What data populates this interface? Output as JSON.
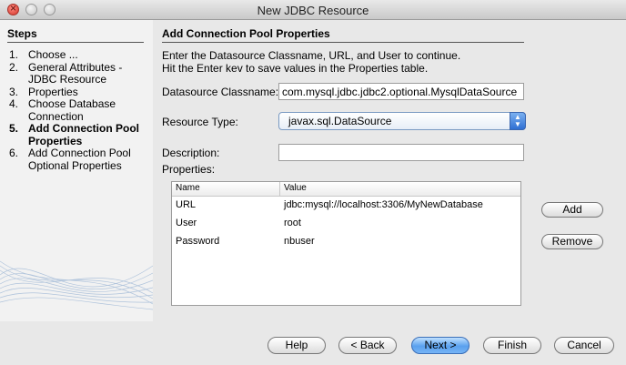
{
  "window": {
    "title": "New JDBC Resource"
  },
  "sidebar": {
    "heading": "Steps",
    "steps": [
      {
        "num": "1.",
        "label": "Choose ..."
      },
      {
        "num": "2.",
        "label": "General Attributes -"
      },
      {
        "num": "",
        "label": "JDBC Resource"
      },
      {
        "num": "3.",
        "label": "Properties"
      },
      {
        "num": "4.",
        "label": "Choose Database"
      },
      {
        "num": "",
        "label": "Connection"
      },
      {
        "num": "5.",
        "label": "Add Connection Pool"
      },
      {
        "num": "",
        "label": "Properties"
      },
      {
        "num": "6.",
        "label": "Add Connection Pool"
      },
      {
        "num": "",
        "label": "Optional Properties"
      }
    ]
  },
  "main": {
    "heading": "Add Connection Pool Properties",
    "instruction_line1": "Enter the Datasource Classname, URL, and User to continue.",
    "instruction_line2": "Hit the Enter kev to save values in the Properties table.",
    "datasource_label": "Datasource Classname:",
    "datasource_value": "com.mysql.jdbc.jdbc2.optional.MysqlDataSource",
    "resource_type_label": "Resource Type:",
    "resource_type_value": "javax.sql.DataSource",
    "description_label": "Description:",
    "description_value": "",
    "properties_label": "Properties:",
    "table": {
      "headers": [
        "Name",
        "Value"
      ],
      "rows": [
        {
          "name": "URL",
          "value": "jdbc:mysql://localhost:3306/MyNewDatabase"
        },
        {
          "name": "User",
          "value": "root"
        },
        {
          "name": "Password",
          "value": "nbuser"
        }
      ]
    },
    "add_label": "Add",
    "remove_label": "Remove"
  },
  "footer": {
    "help": "Help",
    "back": "< Back",
    "next": "Next >",
    "finish": "Finish",
    "cancel": "Cancel"
  },
  "colors": {
    "primary_button": "#5aa0ee",
    "close_button": "#d4362b"
  }
}
